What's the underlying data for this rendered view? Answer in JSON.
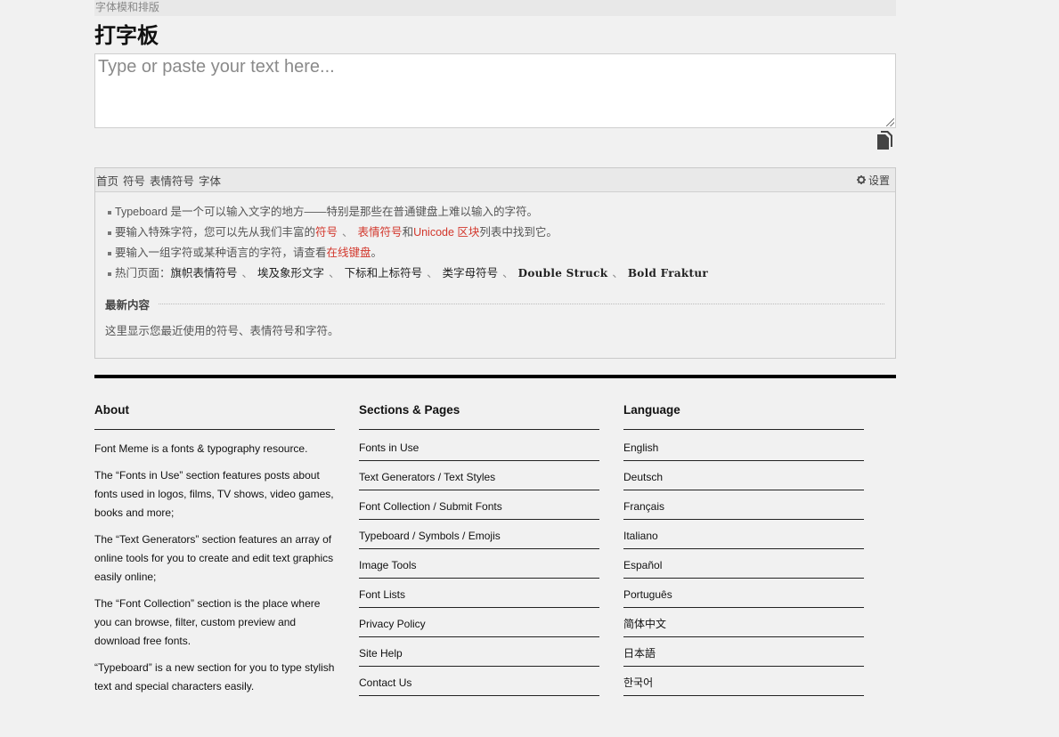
{
  "breadcrumb": "字体模和排版",
  "page_title": "打字板",
  "editor": {
    "placeholder": "Type or paste your text here..."
  },
  "panel": {
    "tabs": [
      "首页",
      "符号",
      "表情符号",
      "字体"
    ],
    "settings_label": "设置",
    "bullets": {
      "b1": "Typeboard 是一个可以输入文字的地方——特别是那些在普通键盘上难以输入的字符。",
      "b2_pre": "要输入特殊字符，您可以先从我们丰富的",
      "b2_link1": "符号",
      "b2_sep": "、",
      "b2_link2": "表情符号",
      "b2_and": "和",
      "b2_link3": "Unicode 区块",
      "b2_post": "列表中找到它。",
      "b3_pre": "要输入一组字符或某种语言的字符，请查看",
      "b3_link": "在线键盘",
      "b3_post": "。",
      "hot_label": "热门页面：",
      "hot_links": [
        "旗帜表情符号",
        "埃及象形文字",
        "下标和上标符号",
        "类字母符号",
        "Double Struck",
        "Bold Fraktur"
      ],
      "hot_sep": "、"
    },
    "recent_title": "最新内容",
    "recent_text": "这里显示您最近使用的符号、表情符号和字符。"
  },
  "footer": {
    "about": {
      "title": "About",
      "p1": "Font Meme is a fonts & typography resource.",
      "p2": "The “Fonts in Use” section features posts about fonts used in logos, films, TV shows, video games, books and more;",
      "p3": "The “Text Generators” section features an array of online tools for you to create and edit text graphics easily online;",
      "p4": "The “Font Collection” section is the place where you can browse, filter, custom preview and download free fonts.",
      "p5": "“Typeboard” is a new section for you to type stylish text and special characters easily."
    },
    "sections": {
      "title": "Sections & Pages",
      "items": [
        "Fonts in Use",
        "Text Generators / Text Styles",
        "Font Collection / Submit Fonts",
        "Typeboard / Symbols / Emojis",
        "Image Tools",
        "Font Lists",
        "Privacy Policy",
        "Site Help",
        "Contact Us"
      ]
    },
    "language": {
      "title": "Language",
      "items": [
        "English",
        "Deutsch",
        "Français",
        "Italiano",
        "Español",
        "Português",
        "简体中文",
        "日本語",
        "한국어"
      ]
    }
  }
}
